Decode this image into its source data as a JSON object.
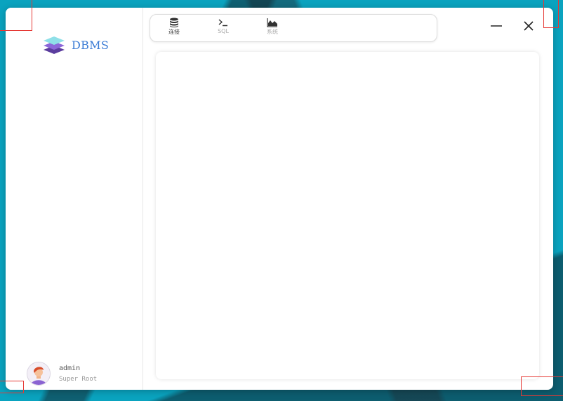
{
  "app": {
    "logo_text": "DBMS",
    "logo_icon": "layers-icon"
  },
  "toolbar": {
    "items": [
      {
        "label": "连接",
        "icon": "database-icon",
        "active": true
      },
      {
        "label": "SQL",
        "icon": "terminal-icon",
        "active": false
      },
      {
        "label": "系统",
        "icon": "area-chart-icon",
        "active": false
      }
    ]
  },
  "window_controls": {
    "minimize_icon": "minimize-icon",
    "close_icon": "close-icon"
  },
  "user": {
    "name": "admin",
    "role": "Super Root",
    "avatar_icon": "user-avatar-icon"
  },
  "colors": {
    "background": "#0aa3bf",
    "accent": "#3a7bd5",
    "window": "#ffffff",
    "marker": "#e53935"
  }
}
